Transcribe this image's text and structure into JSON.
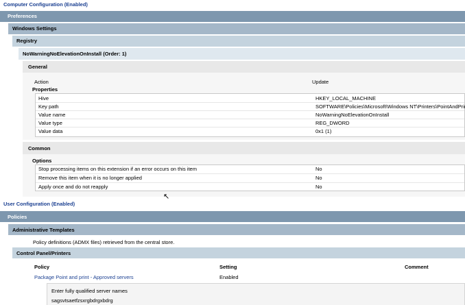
{
  "computer": {
    "title": "Computer Configuration (Enabled)",
    "preferences": "Preferences",
    "windows_settings": "Windows Settings",
    "registry": "Registry",
    "item_title": "NoWarningNoElevationOnInstall (Order: 1)",
    "general": {
      "header": "General",
      "action_label": "Action",
      "action_value": "Update",
      "properties_label": "Properties",
      "properties": [
        {
          "name": "Hive",
          "value": "HKEY_LOCAL_MACHINE"
        },
        {
          "name": "Key path",
          "value": "SOFTWARE\\Policies\\Microsoft\\Windows NT\\Printers\\PointAndPrint"
        },
        {
          "name": "Value name",
          "value": "NoWarningNoElevationOnInstall"
        },
        {
          "name": "Value type",
          "value": "REG_DWORD"
        },
        {
          "name": "Value data",
          "value": "0x1 (1)"
        }
      ]
    },
    "common": {
      "header": "Common",
      "options_label": "Options",
      "options": [
        {
          "name": "Stop processing items on this extension if an error occurs on this item",
          "value": "No"
        },
        {
          "name": "Remove this item when it is no longer applied",
          "value": "No"
        },
        {
          "name": "Apply once and do not reapply",
          "value": "No"
        }
      ]
    }
  },
  "user": {
    "title": "User Configuration (Enabled)",
    "policies": "Policies",
    "admin_templates": "Administrative Templates",
    "admx_note": "Policy definitions (ADMX files) retrieved from the central store.",
    "control_panel": "Control Panel/Printers",
    "columns": {
      "policy": "Policy",
      "setting": "Setting",
      "comment": "Comment"
    },
    "policy_row": {
      "name": "Package Point and print - Approved servers",
      "setting": "Enabled"
    },
    "detail_label": "Enter fully qualified server names",
    "detail_value": "sagsvtsaetfzsxrgbdrgxbdrg"
  },
  "colors": {
    "title_blue": "#1a3f91",
    "level1": "#7e97ae",
    "level2": "#a4b7c8",
    "level3": "#c4d3de",
    "level4": "#dfe8ef"
  }
}
